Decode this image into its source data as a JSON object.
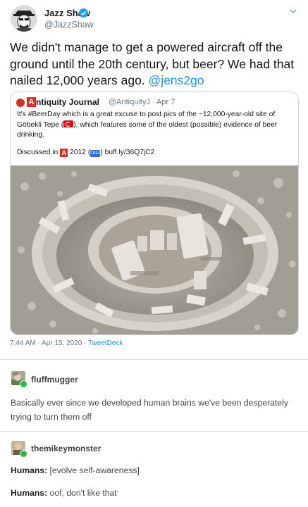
{
  "tweet": {
    "author_name": "Jazz Shaw",
    "author_handle": "@JazzShaw",
    "text_main": "We didn't manage to get a powered aircraft off the ground until the 20th century, but beer? We had that nailed 12,000 years ago. ",
    "text_mention": "@jens2go",
    "quote": {
      "initial": "A",
      "name": "ntiquity Journal",
      "handle": "@AntiquityJ · Apr 7",
      "text_part1": "It's #BeerDay which is a great excuse to post pics of the ~12,000-year-old site of Göbekli Tepe (",
      "text_part2": "), which features some of the oldest (possible) evidence of beer drinking.",
      "discussed_label": "Discussed in",
      "discussed_year": "2012 (",
      "free_badge": "FREE",
      "discussed_link": ") buff.ly/36Q7jC2"
    },
    "timestamp": "7:44 AM · Apr 15, 2020 · ",
    "source": "TweetDeck"
  },
  "posts": [
    {
      "username": "fluffmugger",
      "body": "Basically ever since we developed human brains we've been desperately trying to turn them off"
    },
    {
      "username": "themikeymonster",
      "line1_label": "Humans:",
      "line1_text": " [evolve self-awareness]",
      "line2_label": "Humans:",
      "line2_text": " oof, don't like that"
    }
  ],
  "colors": {
    "link": "#1b95e0",
    "verified": "#1da1f2",
    "journal_red": "#d93025",
    "tumblr_badge": "#1fbf3a"
  }
}
